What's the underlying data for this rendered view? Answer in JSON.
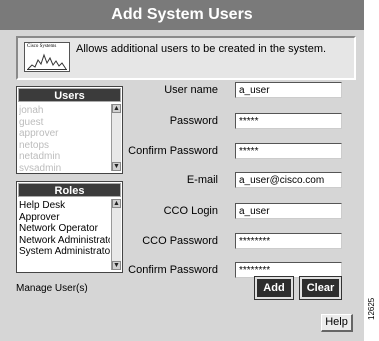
{
  "window": {
    "title": "Add System Users"
  },
  "info": {
    "logo_text": "Cisco Systems",
    "description": "Allows additional users to be created in the system."
  },
  "users_panel": {
    "header": "Users",
    "items": [
      "jonah",
      "guest",
      "approver",
      "netops",
      "netadmin",
      "sysadmin"
    ]
  },
  "roles_panel": {
    "header": "Roles",
    "items": [
      "Help Desk",
      "Approver",
      "Network Operator",
      "Network Administrator",
      "System Administrator"
    ]
  },
  "form": {
    "username_label": "User name",
    "username_value": "a_user",
    "password_label": "Password",
    "password_value": "*****",
    "confirm_password_label": "Confirm Password",
    "confirm_password_value": "*****",
    "email_label": "E-mail",
    "email_value": "a_user@cisco.com",
    "cco_login_label": "CCO Login",
    "cco_login_value": "a_user",
    "cco_password_label": "CCO Password",
    "cco_password_value": "********",
    "cco_confirm_label": "Confirm Password",
    "cco_confirm_value": "********"
  },
  "actions": {
    "add": "Add",
    "clear": "Clear",
    "help": "Help"
  },
  "status": "Manage User(s)",
  "figure_id": "12625",
  "colors": {
    "titlebar": "#7a7a7a",
    "window_bg": "#d6d6d6",
    "dark_button": "#2d2d2d"
  }
}
